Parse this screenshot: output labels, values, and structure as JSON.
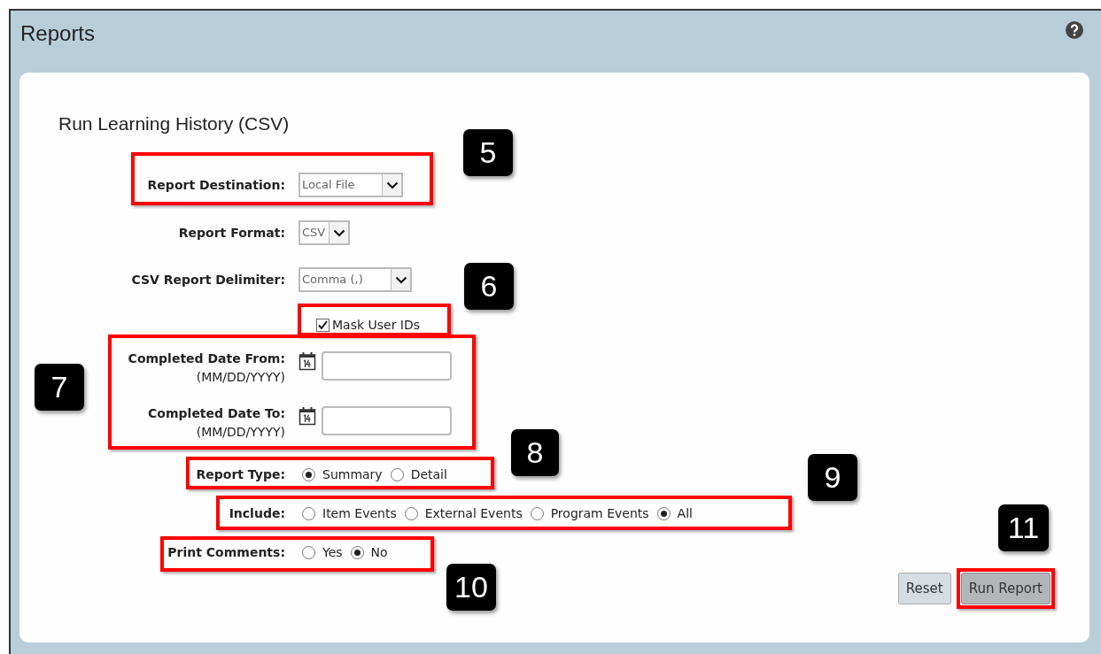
{
  "window": {
    "title": "Reports"
  },
  "form": {
    "title": "Run Learning History (CSV)",
    "fields": [
      {
        "kind": "select",
        "label": "Report Destination:",
        "value": "Local File",
        "highlighted": true
      },
      {
        "kind": "select",
        "label": "Report Format:",
        "value": "CSV",
        "highlighted": false
      },
      {
        "kind": "select",
        "label": "CSV Report Delimiter:",
        "value": "Comma (,)",
        "highlighted": false
      },
      {
        "kind": "checkbox",
        "label": "Mask User IDs",
        "checked": true,
        "highlighted": true
      },
      {
        "kind": "date_range",
        "highlighted": true,
        "rows": [
          {
            "label": "Completed Date From:",
            "hint": "(MM/DD/YYYY)"
          },
          {
            "label": "Completed Date To:",
            "hint": "(MM/DD/YYYY)"
          }
        ]
      },
      {
        "kind": "radio",
        "label": "Report Type:",
        "highlighted": true,
        "options": [
          {
            "label": "Summary",
            "selected": true
          },
          {
            "label": "Detail",
            "selected": false
          }
        ]
      },
      {
        "kind": "radio",
        "label": "Include:",
        "highlighted": true,
        "options": [
          {
            "label": "Item Events",
            "selected": false
          },
          {
            "label": "External Events",
            "selected": false
          },
          {
            "label": "Program Events",
            "selected": false
          },
          {
            "label": "All",
            "selected": true
          }
        ]
      },
      {
        "kind": "radio",
        "label": "Print Comments:",
        "highlighted": true,
        "options": [
          {
            "label": "Yes",
            "selected": false
          },
          {
            "label": "No",
            "selected": true
          }
        ]
      }
    ]
  },
  "buttons": [
    {
      "label": "Reset",
      "kind": "secondary",
      "highlighted": false
    },
    {
      "label": "Run Report",
      "kind": "primary",
      "highlighted": true
    }
  ],
  "callouts": [
    "5",
    "6",
    "7",
    "8",
    "9",
    "10",
    "11"
  ]
}
